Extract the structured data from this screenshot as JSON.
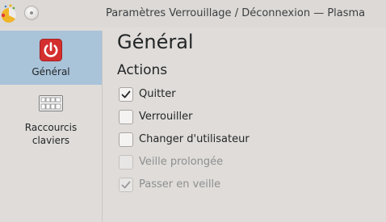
{
  "window": {
    "title": "Paramètres Verrouillage / Déconnexion — Plasma"
  },
  "sidebar": {
    "items": [
      {
        "label": "Général",
        "icon": "power-icon",
        "selected": true
      },
      {
        "label": "Raccourcis\nclaviers",
        "label_line1": "Raccourcis",
        "label_line2": "claviers",
        "icon": "keyboard-icon",
        "selected": false
      }
    ]
  },
  "main": {
    "page_title": "Général",
    "section_title": "Actions",
    "options": [
      {
        "label": "Quitter",
        "checked": true,
        "enabled": true
      },
      {
        "label": "Verrouiller",
        "checked": false,
        "enabled": true
      },
      {
        "label": "Changer d'utilisateur",
        "checked": false,
        "enabled": true
      },
      {
        "label": "Veille prolongée",
        "checked": false,
        "enabled": false
      },
      {
        "label": "Passer en veille",
        "checked": true,
        "enabled": false
      }
    ]
  },
  "colors": {
    "selection": "#a9c3d9",
    "background": "#dfdcd9",
    "power_red": "#d42f2f"
  }
}
